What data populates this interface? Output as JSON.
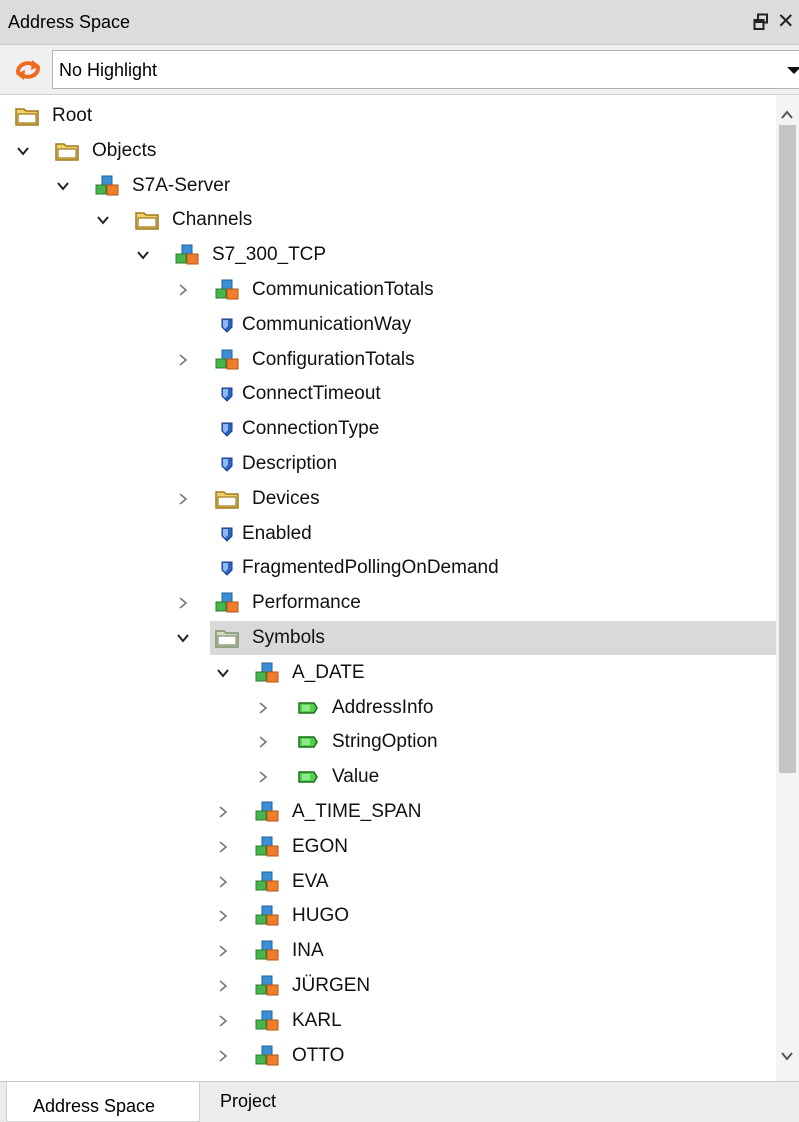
{
  "panel": {
    "title": "Address Space"
  },
  "highlight": {
    "selected": "No Highlight",
    "refresh_icon": "refresh-icon"
  },
  "tree": [
    {
      "label": "Root",
      "icon": "folder",
      "level": 0,
      "expander": "none"
    },
    {
      "label": "Objects",
      "icon": "folder",
      "level": 1,
      "expander": "expanded"
    },
    {
      "label": "S7A-Server",
      "icon": "object",
      "level": 2,
      "expander": "expanded"
    },
    {
      "label": "Channels",
      "icon": "folder",
      "level": 3,
      "expander": "expanded"
    },
    {
      "label": "S7_300_TCP",
      "icon": "object",
      "level": 4,
      "expander": "expanded"
    },
    {
      "label": "CommunicationTotals",
      "icon": "object",
      "level": 5,
      "expander": "collapsed"
    },
    {
      "label": "CommunicationWay",
      "icon": "property",
      "level": 5,
      "expander": "none"
    },
    {
      "label": "ConfigurationTotals",
      "icon": "object",
      "level": 5,
      "expander": "collapsed"
    },
    {
      "label": "ConnectTimeout",
      "icon": "property",
      "level": 5,
      "expander": "none"
    },
    {
      "label": "ConnectionType",
      "icon": "property",
      "level": 5,
      "expander": "none"
    },
    {
      "label": "Description",
      "icon": "property",
      "level": 5,
      "expander": "none"
    },
    {
      "label": "Devices",
      "icon": "folder",
      "level": 5,
      "expander": "collapsed"
    },
    {
      "label": "Enabled",
      "icon": "property",
      "level": 5,
      "expander": "none"
    },
    {
      "label": "FragmentedPollingOnDemand",
      "icon": "property",
      "level": 5,
      "expander": "none"
    },
    {
      "label": "Performance",
      "icon": "object",
      "level": 5,
      "expander": "collapsed"
    },
    {
      "label": "Symbols",
      "icon": "folder-open",
      "level": 5,
      "expander": "expanded",
      "selected": true
    },
    {
      "label": "A_DATE",
      "icon": "object",
      "level": 6,
      "expander": "expanded"
    },
    {
      "label": "AddressInfo",
      "icon": "variable",
      "level": 7,
      "expander": "collapsed"
    },
    {
      "label": "StringOption",
      "icon": "variable",
      "level": 7,
      "expander": "collapsed"
    },
    {
      "label": "Value",
      "icon": "variable",
      "level": 7,
      "expander": "collapsed"
    },
    {
      "label": "A_TIME_SPAN",
      "icon": "object",
      "level": 6,
      "expander": "collapsed"
    },
    {
      "label": "EGON",
      "icon": "object",
      "level": 6,
      "expander": "collapsed"
    },
    {
      "label": "EVA",
      "icon": "object",
      "level": 6,
      "expander": "collapsed"
    },
    {
      "label": "HUGO",
      "icon": "object",
      "level": 6,
      "expander": "collapsed"
    },
    {
      "label": "INA",
      "icon": "object",
      "level": 6,
      "expander": "collapsed"
    },
    {
      "label": "JÜRGEN",
      "icon": "object",
      "level": 6,
      "expander": "collapsed"
    },
    {
      "label": "KARL",
      "icon": "object",
      "level": 6,
      "expander": "collapsed"
    },
    {
      "label": "OTTO",
      "icon": "object",
      "level": 6,
      "expander": "collapsed"
    }
  ],
  "tabs": [
    {
      "label": "Address Space",
      "active": true
    },
    {
      "label": "Project",
      "active": false
    }
  ]
}
